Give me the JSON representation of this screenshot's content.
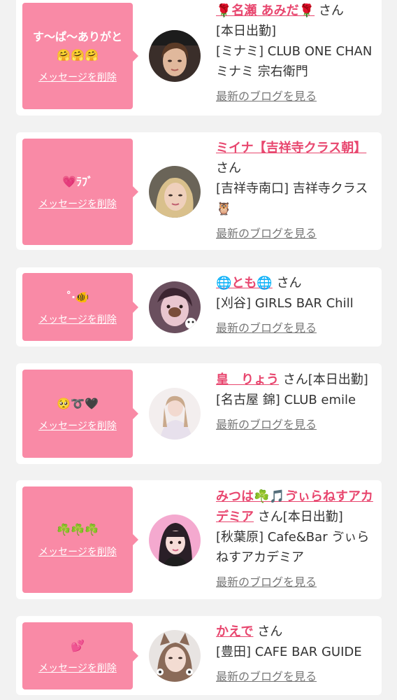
{
  "delete_label": "メッセージを削除",
  "blog_label": "最新のブログを見る",
  "honorific": "さん",
  "colors": {
    "page_background": "#f2f2f2",
    "bubble": "#f98aa6",
    "name": "#e8476f",
    "text": "#333333",
    "link_gray": "#777777"
  },
  "cards": [
    {
      "message": "す〜ぱ〜ありがと\n🤗🤗🤗",
      "name": "🌹名瀬 あみだ🌹",
      "status": "[本日出勤]",
      "shop": "[ミナミ] CLUB ONE CHAN ミナミ 宗右衛門",
      "avatar_icon": "woman-dark-hair-avatar"
    },
    {
      "message": "💗ﾗﾌﾞ",
      "name": "ミイナ【吉祥寺クラス朝】",
      "status": "",
      "shop": "[吉祥寺南口] 吉祥寺クラス🦉",
      "avatar_icon": "woman-blonde-avatar"
    },
    {
      "message": "˚‧🐠",
      "name": "🌐とも🌐",
      "status": "",
      "shop": "[刈谷] GIRLS BAR Chill",
      "avatar_icon": "woman-bear-filter-avatar"
    },
    {
      "message": "🥺➰🖤",
      "name": "皇　りょう",
      "status": "[本日出勤]",
      "shop": "[名古屋 錦] CLUB emile",
      "avatar_icon": "woman-white-dress-avatar"
    },
    {
      "message": "☘️☘️☘️",
      "name": "みつは☘️🎵ゔぃらねすアカデミア",
      "status": "[本日出勤]",
      "shop": "[秋葉原] Cafe&Bar ゔぃらねすアカデミア",
      "avatar_icon": "woman-pink-background-avatar"
    },
    {
      "message": "💕",
      "name": "かえで",
      "status": "",
      "shop": "[豊田] CAFE BAR GUIDE",
      "avatar_icon": "woman-cat-ears-avatar"
    }
  ]
}
